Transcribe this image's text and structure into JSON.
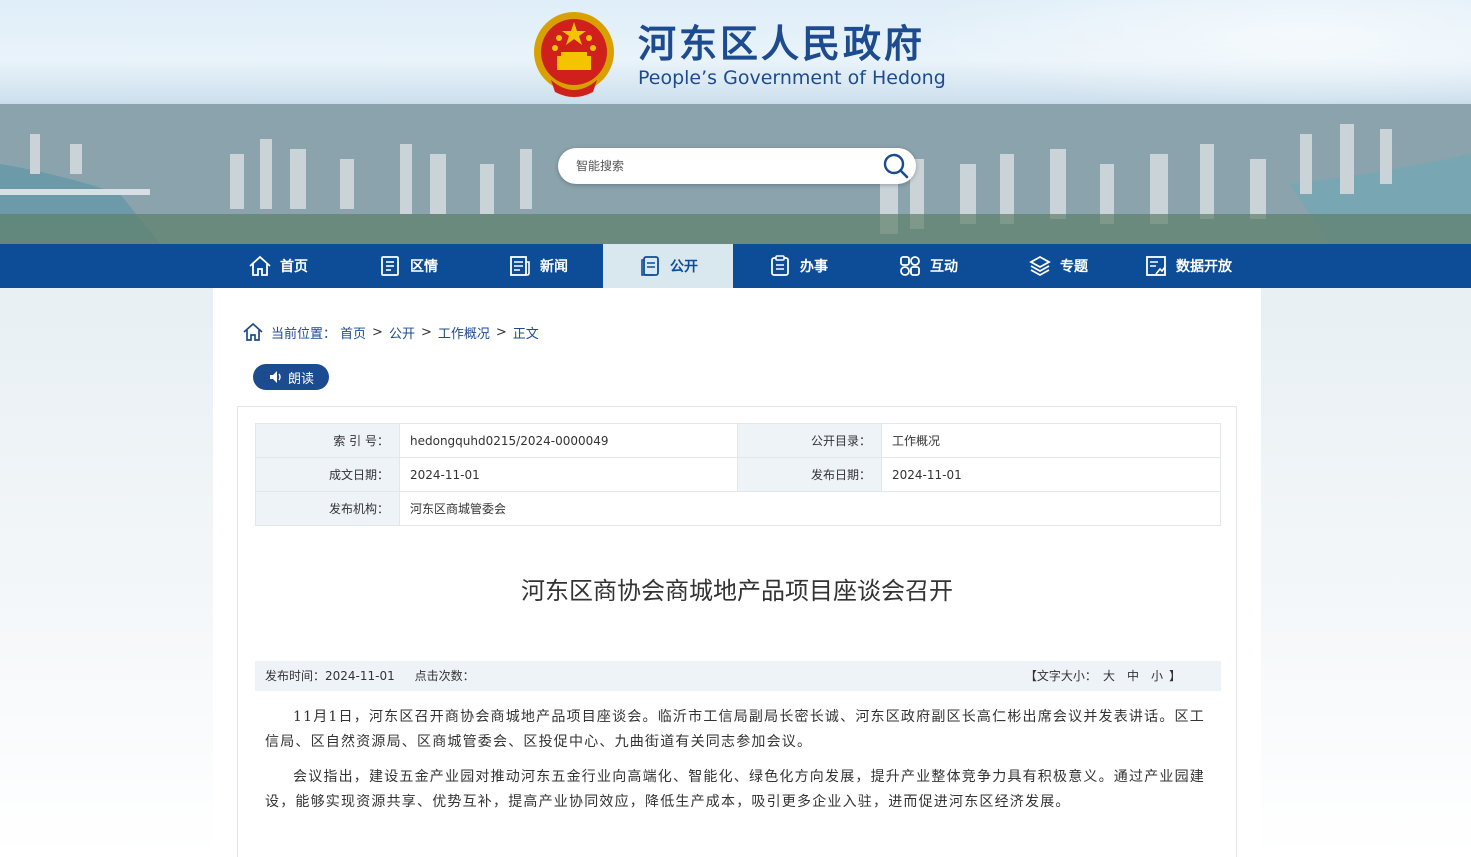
{
  "header": {
    "title": "河东区人民政府",
    "subtitle": "People’s Government of Hedong",
    "search_placeholder": "智能搜索"
  },
  "nav": {
    "items": [
      {
        "label": "首页",
        "icon": "home-icon"
      },
      {
        "label": "区情",
        "icon": "document-icon"
      },
      {
        "label": "新闻",
        "icon": "news-icon"
      },
      {
        "label": "公开",
        "icon": "open-file-icon",
        "active": true
      },
      {
        "label": "办事",
        "icon": "clipboard-icon"
      },
      {
        "label": "互动",
        "icon": "interact-icon"
      },
      {
        "label": "专题",
        "icon": "layers-icon"
      },
      {
        "label": "数据开放",
        "icon": "data-icon"
      }
    ]
  },
  "breadcrumb": {
    "prefix": "当前位置：",
    "items": [
      "首页",
      "公开",
      "工作概况",
      "正文"
    ],
    "separator": ">"
  },
  "read_button": "朗读",
  "meta": {
    "index_label": "索 引 号：",
    "index_value": "hedongquhd0215/2024-0000049",
    "catalog_label": "公开目录：",
    "catalog_value": "工作概况",
    "written_label": "成文日期：",
    "written_value": "2024-11-01",
    "publish_label": "发布日期：",
    "publish_value": "2024-11-01",
    "org_label": "发布机构：",
    "org_value": "河东区商城管委会"
  },
  "article": {
    "title": "河东区商协会商城地产品项目座谈会召开",
    "publish_time": "发布时间：2024-11-01",
    "views": "点击次数：",
    "font_size_prefix": "【文字大小：",
    "font_large": "大",
    "font_medium": "中",
    "font_small": "小",
    "font_size_suffix": "】",
    "paragraphs": [
      "11月1日，河东区召开商协会商城地产品项目座谈会。临沂市工信局副局长密长诚、河东区政府副区长高仁彬出席会议并发表讲话。区工信局、区自然资源局、区商城管委会、区投促中心、九曲街道有关同志参加会议。",
      "会议指出，建设五金产业园对推动河东五金行业向高端化、智能化、绿色化方向发展，提升产业整体竞争力具有积极意义。通过产业园建设，能够实现资源共享、优势互补，提高产业协同效应，降低生产成本，吸引更多企业入驻，进而促进河东区经济发展。"
    ]
  },
  "colors": {
    "nav_bg": "#0d4d97",
    "nav_active_bg": "#d9e7ee",
    "title_blue": "#1d4b8f",
    "meta_label_bg": "#eef3f8"
  }
}
